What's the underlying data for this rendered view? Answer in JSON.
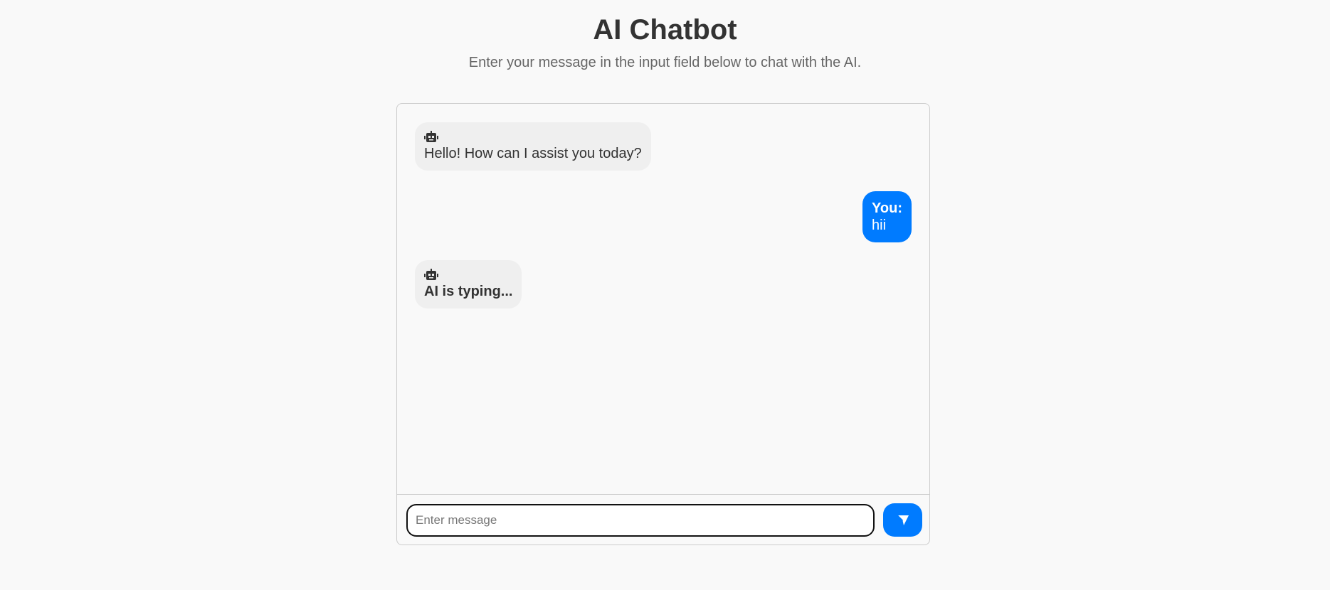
{
  "header": {
    "title": "AI Chatbot",
    "subtitle": "Enter your message in the input field below to chat with the AI."
  },
  "chat": {
    "messages": [
      {
        "sender": "ai",
        "icon": "robot-icon",
        "text": "Hello! How can I assist you today?"
      },
      {
        "sender": "user",
        "label": "You:",
        "text": "hii"
      },
      {
        "sender": "ai",
        "icon": "robot-icon",
        "text": "AI is typing..."
      }
    ]
  },
  "input": {
    "placeholder": "Enter message",
    "value": "",
    "send_icon": "send-icon"
  },
  "colors": {
    "accent": "#007bff",
    "ai_bubble": "#efefef",
    "background": "#f9f9f9",
    "text": "#333333"
  }
}
